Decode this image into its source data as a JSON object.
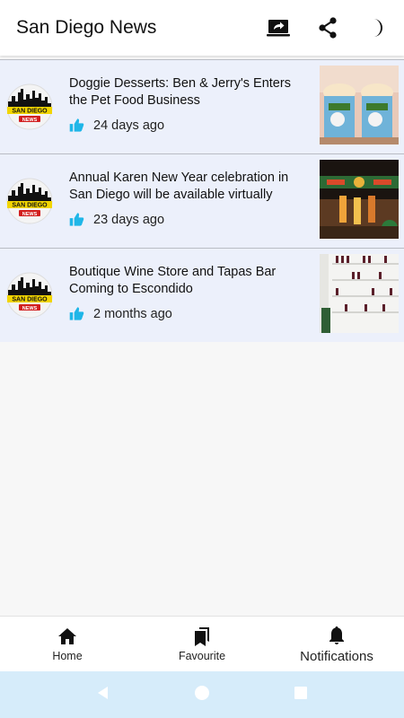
{
  "app": {
    "title": "San Diego News"
  },
  "toolbar": {
    "icons": [
      "screen-share-icon",
      "share-icon",
      "dark-mode-moon-icon"
    ]
  },
  "source_logo": {
    "line1": "SAN DIEGO",
    "line2": "NEWS"
  },
  "articles": [
    {
      "headline": "Doggie Desserts: Ben & Jerry's Enters the Pet Food Business",
      "time": "24 days ago"
    },
    {
      "headline": "Annual Karen New Year celebration in San Diego will be available virtually",
      "time": "23 days ago"
    },
    {
      "headline": "Boutique Wine Store and Tapas Bar Coming to Escondido",
      "time": "2 months ago"
    }
  ],
  "bottom_nav": {
    "home": "Home",
    "favourite": "Favourite",
    "notifications": "Notifications"
  },
  "colors": {
    "accent": "#1fb6e8",
    "card": "#ecf0fb",
    "sysnav": "#d6ecfa"
  }
}
